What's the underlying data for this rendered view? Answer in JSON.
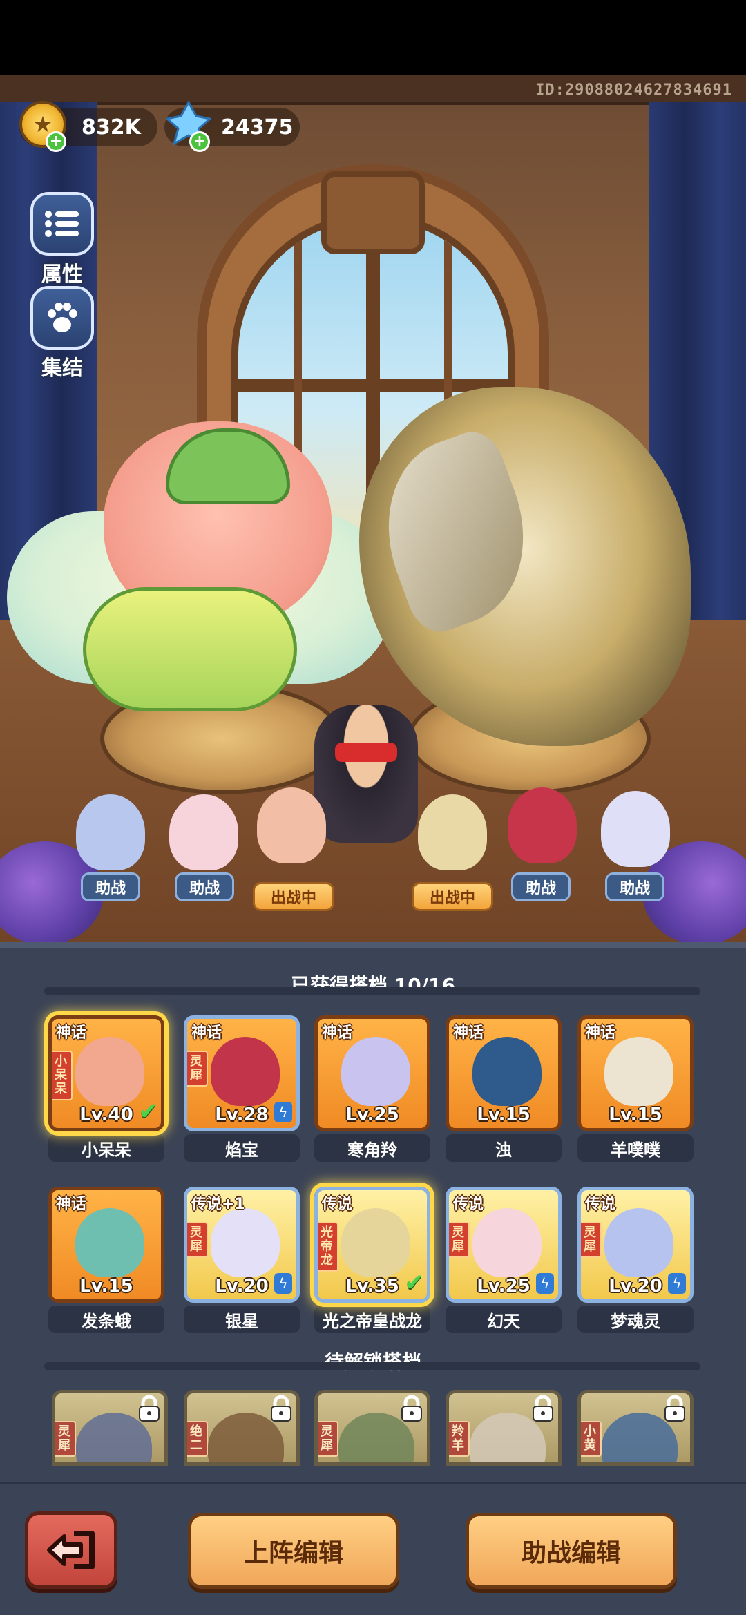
{
  "header": {
    "player_id": "ID:29088024627834691",
    "gold": "832K",
    "gems": "24375"
  },
  "side_menu": [
    {
      "label": "属性",
      "icon": "list-icon"
    },
    {
      "label": "集结",
      "icon": "paw-icon"
    }
  ],
  "lineup": [
    {
      "tag": "助战",
      "color": "#b7c7ee"
    },
    {
      "tag": "助战",
      "color": "#f7d3dc"
    },
    {
      "tag": "出战中",
      "color": "#f3bea6"
    },
    {
      "tag": "出战中",
      "color": "#e8d9a6"
    },
    {
      "tag": "助战",
      "color": "#c7354b"
    },
    {
      "tag": "助战",
      "color": "#dfe0f7"
    }
  ],
  "owned": {
    "title": "已获得搭档 10/16",
    "cards": [
      {
        "rarity": "神话",
        "level": "Lv.40",
        "name": "小呆呆",
        "ribbon": "小呆呆",
        "status": "check",
        "selected": true,
        "frame": "myth",
        "color": "#f2a88f"
      },
      {
        "rarity": "神话",
        "level": "Lv.28",
        "name": "焰宝",
        "ribbon": "灵犀",
        "status": "bolt",
        "selected": false,
        "frame": "myth-blue",
        "color": "#c2344a"
      },
      {
        "rarity": "神话",
        "level": "Lv.25",
        "name": "寒角羚",
        "ribbon": "",
        "status": "",
        "selected": false,
        "frame": "myth",
        "color": "#c9c3f0"
      },
      {
        "rarity": "神话",
        "level": "Lv.15",
        "name": "浊",
        "ribbon": "",
        "status": "",
        "selected": false,
        "frame": "myth",
        "color": "#2f5b8c"
      },
      {
        "rarity": "神话",
        "level": "Lv.15",
        "name": "羊噗噗",
        "ribbon": "",
        "status": "",
        "selected": false,
        "frame": "myth",
        "color": "#ece4d1"
      },
      {
        "rarity": "神话",
        "level": "Lv.15",
        "name": "发条蛾",
        "ribbon": "",
        "status": "",
        "selected": false,
        "frame": "myth",
        "color": "#6fbfb0"
      },
      {
        "rarity": "传说+1",
        "level": "Lv.20",
        "name": "银星",
        "ribbon": "灵犀",
        "status": "bolt",
        "selected": false,
        "frame": "legend",
        "color": "#e3e0f7"
      },
      {
        "rarity": "传说",
        "level": "Lv.35",
        "name": "光之帝皇战龙",
        "ribbon": "光帝龙",
        "status": "check",
        "selected": true,
        "frame": "legend",
        "color": "#e6d59a"
      },
      {
        "rarity": "传说",
        "level": "Lv.25",
        "name": "幻天",
        "ribbon": "灵犀",
        "status": "bolt",
        "selected": false,
        "frame": "legend",
        "color": "#f6d6dc"
      },
      {
        "rarity": "传说",
        "level": "Lv.20",
        "name": "梦魂灵",
        "ribbon": "灵犀",
        "status": "bolt",
        "selected": false,
        "frame": "legend",
        "color": "#b6c3ee"
      }
    ]
  },
  "locked": {
    "title": "待解锁搭档",
    "cards": [
      {
        "ribbon": "灵犀",
        "color": "#5c6fa6"
      },
      {
        "ribbon": "绝二",
        "color": "#8a5a2e"
      },
      {
        "ribbon": "灵犀",
        "color": "#6b8a4a"
      },
      {
        "ribbon": "羚羊",
        "color": "#d9c9b0"
      },
      {
        "ribbon": "小黄",
        "color": "#3a6fb0"
      }
    ]
  },
  "buttons": {
    "lineup_edit": "上阵编辑",
    "assist_edit": "助战编辑"
  }
}
